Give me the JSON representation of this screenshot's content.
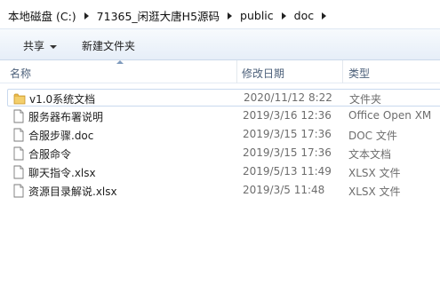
{
  "breadcrumb": {
    "items": [
      "本地磁盘 (C:)",
      "71365_闲逛大唐H5源码",
      "public",
      "doc"
    ]
  },
  "toolbar": {
    "share_label": "共享",
    "new_folder_label": "新建文件夹"
  },
  "columns": {
    "name": "名称",
    "date": "修改日期",
    "type": "类型"
  },
  "files": [
    {
      "name": "v1.0系统文档",
      "date": "2020/11/12 8:22",
      "type": "文件夹",
      "icon": "folder-icon"
    },
    {
      "name": "服务器布署说明",
      "date": "2019/3/16 12:36",
      "type": "Office Open XM",
      "icon": "document-icon"
    },
    {
      "name": "合服步骤.doc",
      "date": "2019/3/15 17:36",
      "type": "DOC 文件",
      "icon": "document-icon"
    },
    {
      "name": "合服命令",
      "date": "2019/3/15 17:36",
      "type": "文本文档",
      "icon": "document-icon"
    },
    {
      "name": "聊天指令.xlsx",
      "date": "2019/5/13 11:49",
      "type": "XLSX 文件",
      "icon": "document-icon"
    },
    {
      "name": "资源目录解说.xlsx",
      "date": "2019/3/5 11:48",
      "type": "XLSX 文件",
      "icon": "document-icon"
    }
  ],
  "colors": {
    "folder": "#e8b84a",
    "selection_border": "#c9d9ee",
    "toolbar_top": "#f7fafd",
    "toolbar_bottom": "#e6eef8"
  }
}
